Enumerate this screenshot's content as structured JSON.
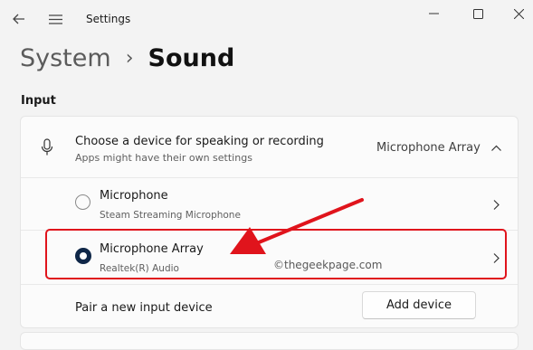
{
  "window": {
    "title": "Settings"
  },
  "breadcrumb": {
    "parent": "System",
    "separator": "›",
    "current": "Sound"
  },
  "input_section": {
    "heading": "Input",
    "chooser": {
      "title": "Choose a device for speaking or recording",
      "subtitle": "Apps might have their own settings",
      "selected_value": "Microphone Array"
    },
    "devices": [
      {
        "name": "Microphone",
        "detail": "Steam Streaming Microphone",
        "selected": false
      },
      {
        "name": "Microphone Array",
        "detail": "Realtek(R) Audio",
        "selected": true
      }
    ],
    "pair": {
      "label": "Pair a new input device",
      "button": "Add device"
    }
  },
  "watermark": "©thegeekpage.com",
  "colors": {
    "background": "#f3f3f3",
    "card": "#fbfbfb",
    "highlight": "#e0141c",
    "arrow": "#e0141c",
    "radio_selected": "#0f2748"
  }
}
